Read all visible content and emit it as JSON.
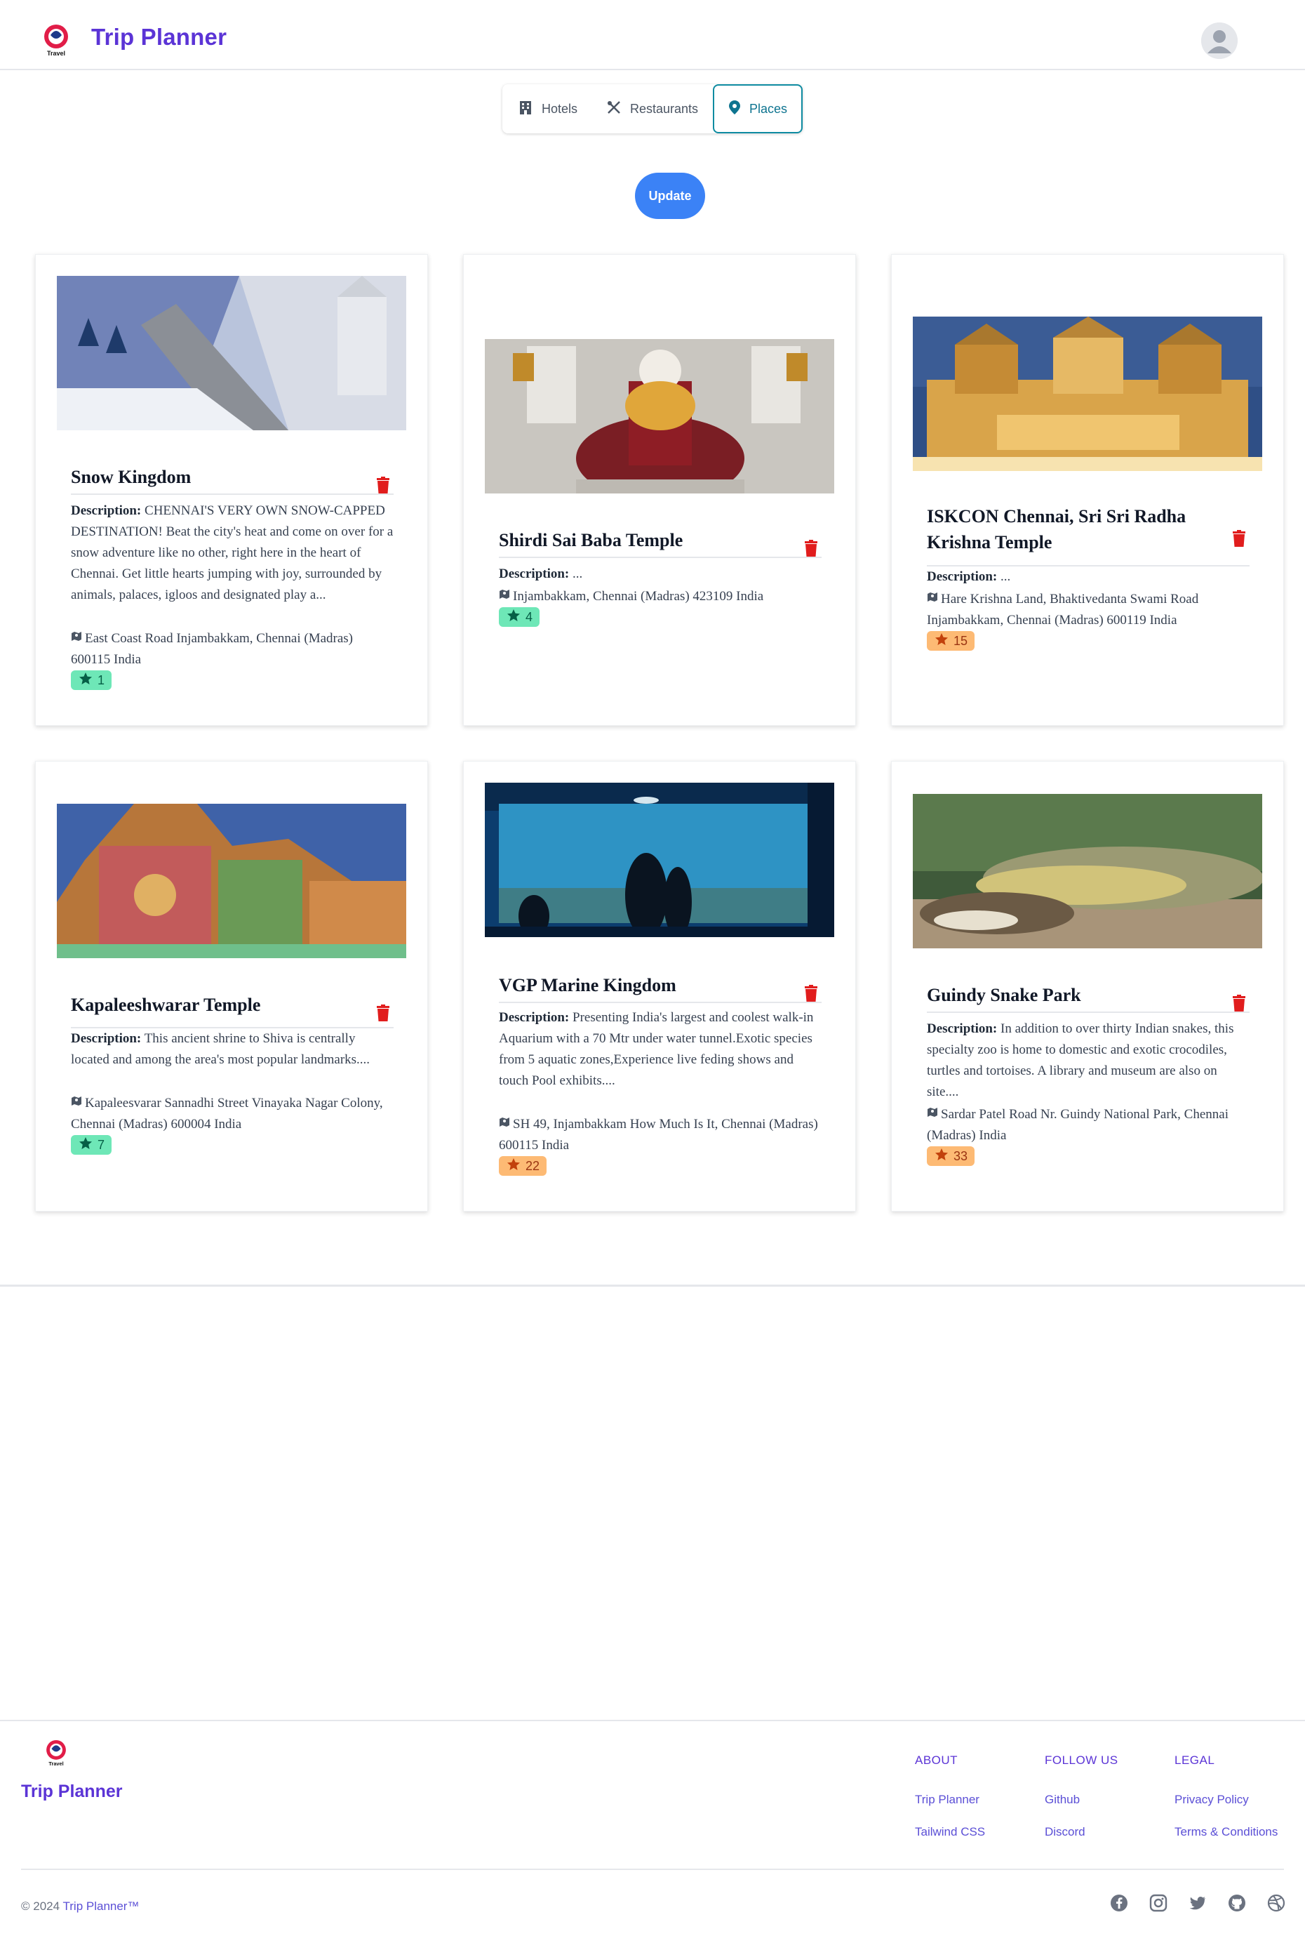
{
  "header": {
    "brand": "Trip Planner",
    "logo_icon": "travel-logo-icon",
    "avatar_icon": "user-avatar-icon"
  },
  "tabs": [
    {
      "label": "Hotels",
      "icon": "building-icon",
      "active": false
    },
    {
      "label": "Restaurants",
      "icon": "utensils-icon",
      "active": false
    },
    {
      "label": "Places",
      "icon": "map-pin-icon",
      "active": true
    }
  ],
  "update_label": "Update",
  "description_label": "Description:",
  "cards": [
    {
      "title": "Snow Kingdom",
      "description": "CHENNAI'S VERY OWN SNOW-CAPPED DESTINATION! Beat the city's heat and come on over for a snow adventure like no other, right here in the heart of Chennai. Get little hearts jumping with joy, surrounded by animals, palaces, igloos and designated play a...",
      "address": "East Coast Road Injambakkam, Chennai (Madras) 600115 India",
      "rating": "1",
      "badge_color": "#6ee7b7"
    },
    {
      "title": "Shirdi Sai Baba Temple",
      "description": "...",
      "address": "Injambakkam, Chennai (Madras) 423109 India",
      "rating": "4",
      "badge_color": "#6ee7b7"
    },
    {
      "title": "ISKCON Chennai, Sri Sri Radha Krishna Temple",
      "description": "...",
      "address": "Hare Krishna Land, Bhaktivedanta Swami Road Injambakkam, Chennai (Madras) 600119 India",
      "rating": "15",
      "badge_color": "#fdba74"
    },
    {
      "title": "Kapaleeshwarar Temple",
      "description": "This ancient shrine to Shiva is centrally located and among the area's most popular landmarks....",
      "address": "Kapaleesvarar Sannadhi Street Vinayaka Nagar Colony, Chennai (Madras) 600004 India",
      "rating": "7",
      "badge_color": "#6ee7b7"
    },
    {
      "title": "VGP Marine Kingdom",
      "description": "Presenting India's largest and coolest walk-in Aquarium with a 70 Mtr under water tunnel.Exotic species from 5 aquatic zones,Experience live feding shows and touch Pool exhibits....",
      "address": "SH 49, Injambakkam How Much Is It, Chennai (Madras) 600115 India",
      "rating": "22",
      "badge_color": "#fdba74"
    },
    {
      "title": "Guindy Snake Park",
      "description": "In addition to over thirty Indian snakes, this specialty zoo is home to domestic and exotic crocodiles, turtles and tortoises. A library and museum are also on site....",
      "address": "Sardar Patel Road Nr. Guindy National Park, Chennai (Madras) India",
      "rating": "33",
      "badge_color": "#fdba74"
    }
  ],
  "footer": {
    "brand": "Trip Planner",
    "columns": [
      {
        "heading": "ABOUT",
        "links": [
          "Trip Planner",
          "Tailwind CSS"
        ]
      },
      {
        "heading": "FOLLOW US",
        "links": [
          "Github",
          "Discord"
        ]
      },
      {
        "heading": "LEGAL",
        "links": [
          "Privacy Policy",
          "Terms & Conditions"
        ]
      }
    ],
    "copyright_prefix": "© 2024",
    "copyright_brand": "Trip Planner™",
    "social_icons": [
      "facebook-icon",
      "instagram-icon",
      "twitter-icon",
      "github-icon",
      "dribbble-icon"
    ]
  },
  "colors": {
    "brand": "#5b34d6",
    "update_button": "#3b82f6",
    "active_tab": "#0e8ba1",
    "trash": "#e11d1d"
  }
}
